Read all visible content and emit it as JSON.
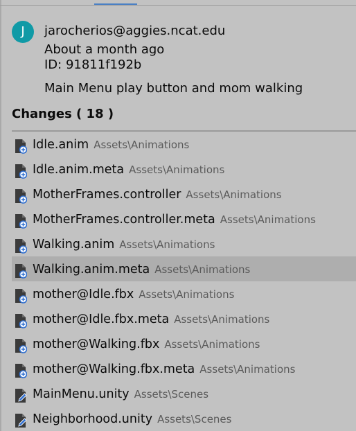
{
  "commit": {
    "avatar_initial": "J",
    "author_email": "jarocherios@aggies.ncat.edu",
    "time": "About a month ago",
    "id": "ID: 91811f192b",
    "message": "Main Menu play button and mom walking"
  },
  "changes": {
    "header": "Changes ( 18 )",
    "items": [
      {
        "name": "Idle.anim",
        "path": "Assets\\Animations",
        "icon": "file-added-icon"
      },
      {
        "name": "Idle.anim.meta",
        "path": "Assets\\Animations",
        "icon": "file-added-icon"
      },
      {
        "name": "MotherFrames.controller",
        "path": "Assets\\Animations",
        "icon": "file-added-icon"
      },
      {
        "name": "MotherFrames.controller.meta",
        "path": "Assets\\Animations",
        "icon": "file-added-icon"
      },
      {
        "name": "Walking.anim",
        "path": "Assets\\Animations",
        "icon": "file-added-icon"
      },
      {
        "name": "Walking.anim.meta",
        "path": "Assets\\Animations",
        "icon": "file-added-icon"
      },
      {
        "name": "mother@Idle.fbx",
        "path": "Assets\\Animations",
        "icon": "file-added-icon"
      },
      {
        "name": "mother@Idle.fbx.meta",
        "path": "Assets\\Animations",
        "icon": "file-added-icon"
      },
      {
        "name": "mother@Walking.fbx",
        "path": "Assets\\Animations",
        "icon": "file-added-icon"
      },
      {
        "name": "mother@Walking.fbx.meta",
        "path": "Assets\\Animations",
        "icon": "file-added-icon"
      },
      {
        "name": "MainMenu.unity",
        "path": "Assets\\Scenes",
        "icon": "file-modified-icon"
      },
      {
        "name": "Neighborhood.unity",
        "path": "Assets\\Scenes",
        "icon": "file-modified-icon"
      }
    ]
  },
  "colors": {
    "background": "#c2c2c2",
    "avatar": "#109aa6",
    "tab_accent": "#4b80c4",
    "selected_row": "#aeaeae",
    "badge_blue": "#2f6fd1"
  }
}
